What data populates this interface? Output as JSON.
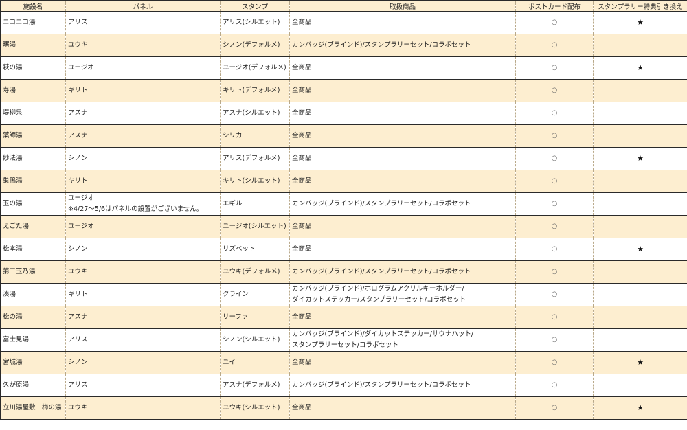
{
  "table": {
    "headers": [
      "施設名",
      "パネル",
      "スタンプ",
      "取扱商品",
      "ポストカード配布",
      "スタンプラリー特典引き換え"
    ],
    "rows": [
      {
        "facility": "ニコニコ湯",
        "panel": [
          "アリス"
        ],
        "stamp": "アリス(シルエット)",
        "products": [
          "全商品"
        ],
        "postcard": "○",
        "reward": "★"
      },
      {
        "facility": "曙湯",
        "panel": [
          "ユウキ"
        ],
        "stamp": "シノン(デフォルメ)",
        "products": [
          "カンバッジ(ブラインド)/スタンプラリーセット/コラボセット"
        ],
        "postcard": "○",
        "reward": ""
      },
      {
        "facility": "萩の湯",
        "panel": [
          "ユージオ"
        ],
        "stamp": "ユージオ(デフォルメ)",
        "products": [
          "全商品"
        ],
        "postcard": "○",
        "reward": "★"
      },
      {
        "facility": "寿湯",
        "panel": [
          "キリト"
        ],
        "stamp": "キリト(デフォルメ)",
        "products": [
          "全商品"
        ],
        "postcard": "○",
        "reward": ""
      },
      {
        "facility": "堤柳泉",
        "panel": [
          "アスナ"
        ],
        "stamp": "アスナ(シルエット)",
        "products": [
          "全商品"
        ],
        "postcard": "○",
        "reward": ""
      },
      {
        "facility": "薬師湯",
        "panel": [
          "アスナ"
        ],
        "stamp": "シリカ",
        "products": [
          "全商品"
        ],
        "postcard": "○",
        "reward": ""
      },
      {
        "facility": "妙法湯",
        "panel": [
          "シノン"
        ],
        "stamp": "アリス(デフォルメ)",
        "products": [
          "全商品"
        ],
        "postcard": "○",
        "reward": "★"
      },
      {
        "facility": "巣鴨湯",
        "panel": [
          "キリト"
        ],
        "stamp": "キリト(シルエット)",
        "products": [
          "全商品"
        ],
        "postcard": "○",
        "reward": ""
      },
      {
        "facility": "玉の湯",
        "panel": [
          "ユージオ",
          "※4/27～5/6はパネルの設置がございません。"
        ],
        "stamp": "エギル",
        "products": [
          "カンバッジ(ブラインド)/スタンプラリーセット/コラボセット"
        ],
        "postcard": "○",
        "reward": ""
      },
      {
        "facility": "えごた湯",
        "panel": [
          "ユージオ"
        ],
        "stamp": "ユージオ(シルエット)",
        "products": [
          "全商品"
        ],
        "postcard": "○",
        "reward": ""
      },
      {
        "facility": "松本湯",
        "panel": [
          "シノン"
        ],
        "stamp": "リズベット",
        "products": [
          "全商品"
        ],
        "postcard": "○",
        "reward": "★"
      },
      {
        "facility": "第三玉乃湯",
        "panel": [
          "ユウキ"
        ],
        "stamp": "ユウキ(デフォルメ)",
        "products": [
          "カンバッジ(ブラインド)/スタンプラリーセット/コラボセット"
        ],
        "postcard": "○",
        "reward": ""
      },
      {
        "facility": "湊湯",
        "panel": [
          "キリト"
        ],
        "stamp": "クライン",
        "products": [
          "カンバッジ(ブラインド)/ホログラムアクリルキーホルダー/",
          "ダイカットステッカー/スタンプラリーセット/コラボセット"
        ],
        "postcard": "○",
        "reward": ""
      },
      {
        "facility": "松の湯",
        "panel": [
          "アスナ"
        ],
        "stamp": "リーファ",
        "products": [
          "全商品"
        ],
        "postcard": "○",
        "reward": ""
      },
      {
        "facility": "富士見湯",
        "panel": [
          "アリス"
        ],
        "stamp": "シノン(シルエット)",
        "products": [
          "カンバッジ(ブラインド)/ダイカットステッカー/サウナハット/",
          "スタンプラリーセット/コラボセット"
        ],
        "postcard": "○",
        "reward": ""
      },
      {
        "facility": "宮城湯",
        "panel": [
          "シノン"
        ],
        "stamp": "ユイ",
        "products": [
          "全商品"
        ],
        "postcard": "○",
        "reward": "★"
      },
      {
        "facility": "久が原湯",
        "panel": [
          "アリス"
        ],
        "stamp": "アスナ(デフォルメ)",
        "products": [
          "カンバッジ(ブラインド)/スタンプラリーセット/コラボセット"
        ],
        "postcard": "○",
        "reward": ""
      },
      {
        "facility": "立川湯屋敷　梅の湯",
        "panel": [
          "ユウキ"
        ],
        "stamp": "ユウキ(シルエット)",
        "products": [
          "全商品"
        ],
        "postcard": "○",
        "reward": "★"
      }
    ]
  }
}
